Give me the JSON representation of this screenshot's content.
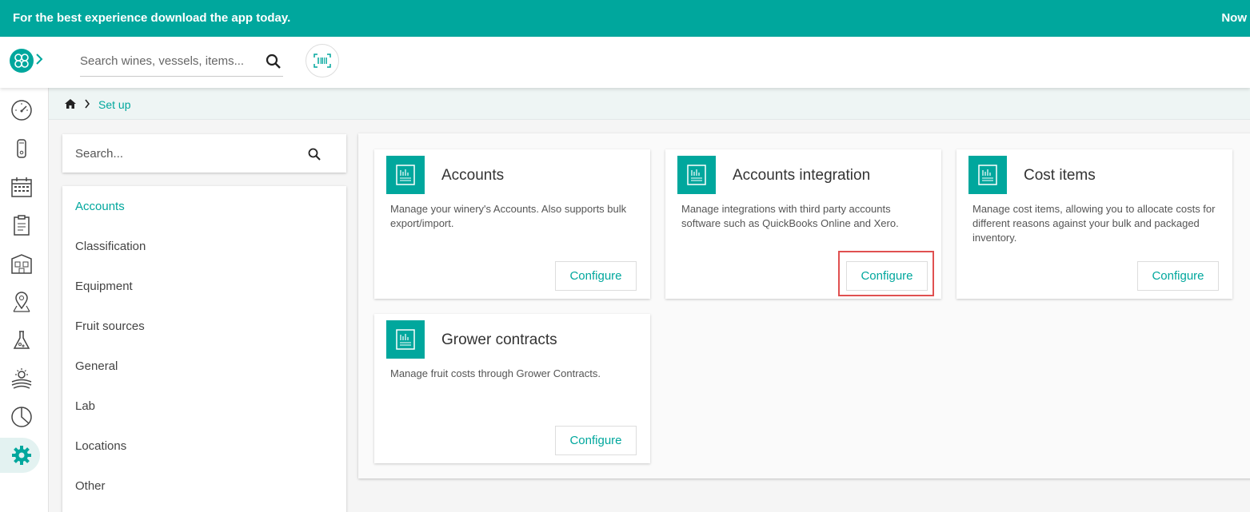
{
  "banner": {
    "message": "For the best experience download the app today.",
    "action": "Now"
  },
  "topbar": {
    "search_placeholder": "Search wines, vessels, items..."
  },
  "sidenav": {
    "items": [
      {
        "icon": "dashboard-gauge-icon"
      },
      {
        "icon": "vessel-tank-icon"
      },
      {
        "icon": "calendar-icon"
      },
      {
        "icon": "clipboard-icon"
      },
      {
        "icon": "winery-building-icon"
      },
      {
        "icon": "location-pin-icon"
      },
      {
        "icon": "lab-flask-icon"
      },
      {
        "icon": "vineyard-sun-icon"
      },
      {
        "icon": "reports-pie-icon"
      },
      {
        "icon": "settings-gear-icon",
        "active": true
      }
    ]
  },
  "breadcrumb": {
    "current": "Set up"
  },
  "left_panel": {
    "search_placeholder": "Search...",
    "categories": [
      "Accounts",
      "Classification",
      "Equipment",
      "Fruit sources",
      "General",
      "Lab",
      "Locations",
      "Other"
    ],
    "active": "Accounts"
  },
  "cards": [
    {
      "title": "Accounts",
      "description": "Manage your winery's Accounts. Also supports bulk export/import.",
      "button": "Configure"
    },
    {
      "title": "Accounts integration",
      "description": "Manage integrations with third party accounts software such as QuickBooks Online and Xero.",
      "button": "Configure"
    },
    {
      "title": "Cost items",
      "description": "Manage cost items, allowing you to allocate costs for different reasons against your bulk and packaged inventory.",
      "button": "Configure"
    },
    {
      "title": "Grower contracts",
      "description": "Manage fruit costs through Grower Contracts.",
      "button": "Configure"
    }
  ],
  "colors": {
    "accent": "#00a79d",
    "highlight": "#e05050"
  }
}
